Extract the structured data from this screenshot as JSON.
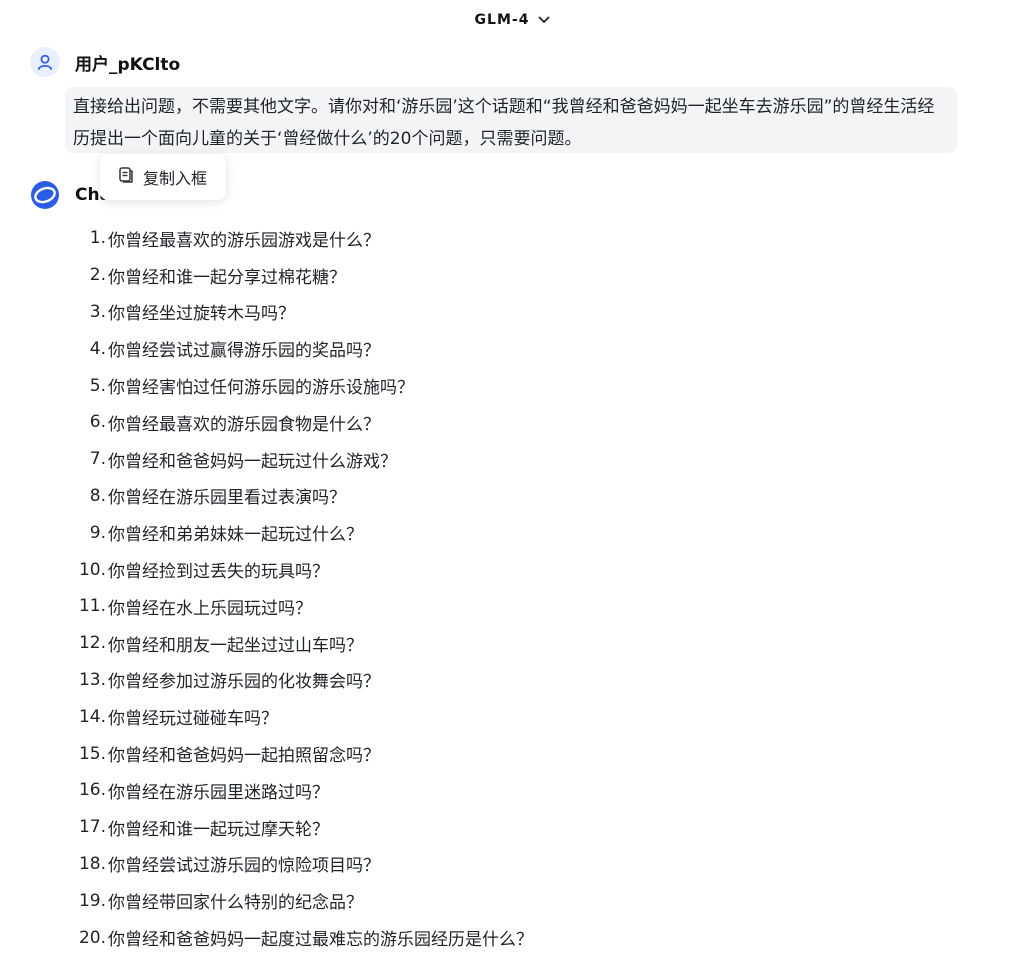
{
  "header": {
    "model_name": "GLM-4"
  },
  "user": {
    "name": "用户_pKClto",
    "message": "直接给出问题，不需要其他文字。请你对和‘游乐园’这个话题和“我曾经和爸爸妈妈一起坐车去游乐园”的曾经生活经历提出一个面向儿童的关于‘曾经做什么’的20个问题，只需要问题。"
  },
  "popover": {
    "copy_label": "复制入框"
  },
  "assistant": {
    "name": "ChatGLM"
  },
  "questions": [
    {
      "num": "1.",
      "text": "你曾经最喜欢的游乐园游戏是什么？"
    },
    {
      "num": "2.",
      "text": "你曾经和谁一起分享过棉花糖？"
    },
    {
      "num": "3.",
      "text": "你曾经坐过旋转木马吗？"
    },
    {
      "num": "4.",
      "text": "你曾经尝试过赢得游乐园的奖品吗？"
    },
    {
      "num": "5.",
      "text": "你曾经害怕过任何游乐园的游乐设施吗？"
    },
    {
      "num": "6.",
      "text": "你曾经最喜欢的游乐园食物是什么？"
    },
    {
      "num": "7.",
      "text": "你曾经和爸爸妈妈一起玩过什么游戏？"
    },
    {
      "num": "8.",
      "text": "你曾经在游乐园里看过表演吗？"
    },
    {
      "num": "9.",
      "text": "你曾经和弟弟妹妹一起玩过什么？"
    },
    {
      "num": "10.",
      "text": "你曾经捡到过丢失的玩具吗？"
    },
    {
      "num": "11.",
      "text": "你曾经在水上乐园玩过吗？"
    },
    {
      "num": "12.",
      "text": "你曾经和朋友一起坐过过山车吗？"
    },
    {
      "num": "13.",
      "text": "你曾经参加过游乐园的化妆舞会吗？"
    },
    {
      "num": "14.",
      "text": "你曾经玩过碰碰车吗？"
    },
    {
      "num": "15.",
      "text": "你曾经和爸爸妈妈一起拍照留念吗？"
    },
    {
      "num": "16.",
      "text": "你曾经在游乐园里迷路过吗？"
    },
    {
      "num": "17.",
      "text": "你曾经和谁一起玩过摩天轮？"
    },
    {
      "num": "18.",
      "text": "你曾经尝试过游乐园的惊险项目吗？"
    },
    {
      "num": "19.",
      "text": "你曾经带回家什么特别的纪念品？"
    },
    {
      "num": "20.",
      "text": "你曾经和爸爸妈妈一起度过最难忘的游乐园经历是什么？"
    }
  ],
  "icons": {
    "model_chevron": "chevron-down-icon",
    "user_avatar": "user-icon",
    "assistant_logo": "chatglm-logo-icon",
    "copy": "copy-icon"
  },
  "colors": {
    "accent": "#2b5ce6",
    "bubble_bg": "#f3f4f6"
  }
}
